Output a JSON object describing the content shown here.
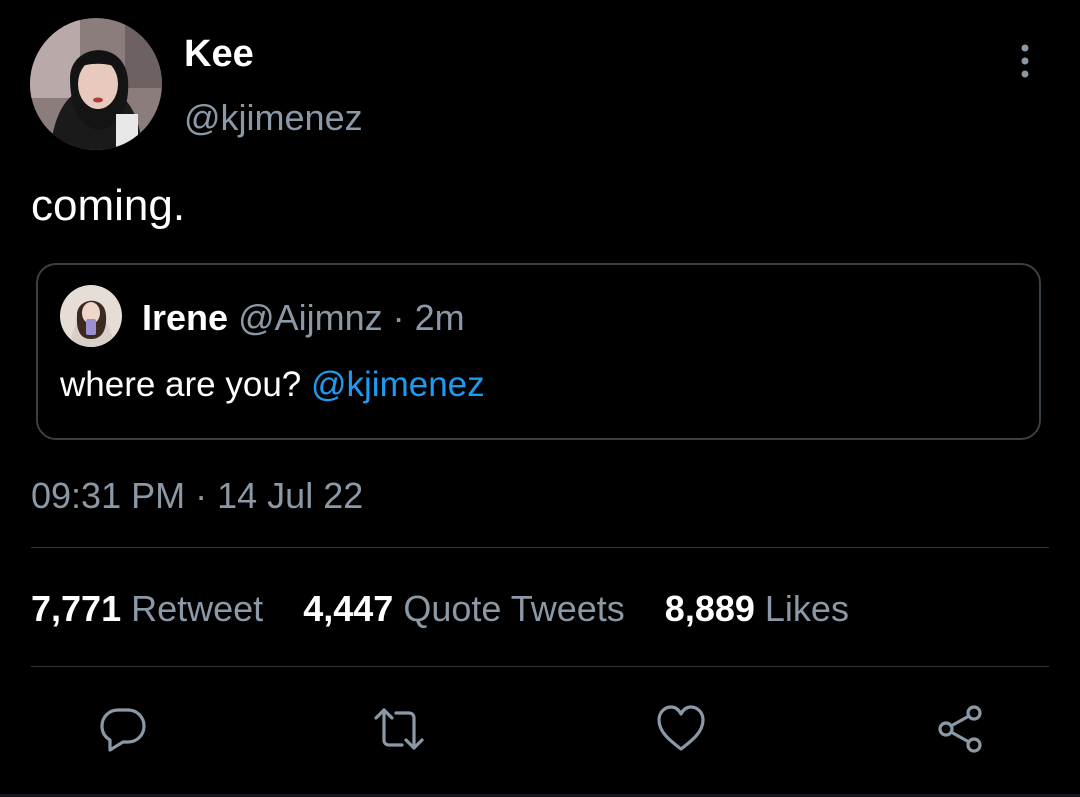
{
  "tweet": {
    "author": {
      "display_name": "Kee",
      "handle": "@kjimenez"
    },
    "text": "coming.",
    "quoted": {
      "author_name": "Irene",
      "author_handle": "@Aijmnz",
      "separator": "·",
      "age": "2m",
      "text": "where are you?",
      "mention": "@kjimenez"
    },
    "time": "09:31 PM",
    "date_separator": "·",
    "date": "14 Jul 22",
    "stats": {
      "retweets": {
        "count": "7,771",
        "label": "Retweet"
      },
      "quotes": {
        "count": "4,447",
        "label": "Quote Tweets"
      },
      "likes": {
        "count": "8,889",
        "label": "Likes"
      }
    }
  },
  "actions": {
    "reply_icon": "reply-icon",
    "retweet_icon": "retweet-icon",
    "like_icon": "heart-icon",
    "share_icon": "share-icon"
  },
  "colors": {
    "background": "#000000",
    "text_primary": "#ffffff",
    "text_secondary": "#8b98a5",
    "accent": "#1d9bf0",
    "border": "#3a4047"
  }
}
